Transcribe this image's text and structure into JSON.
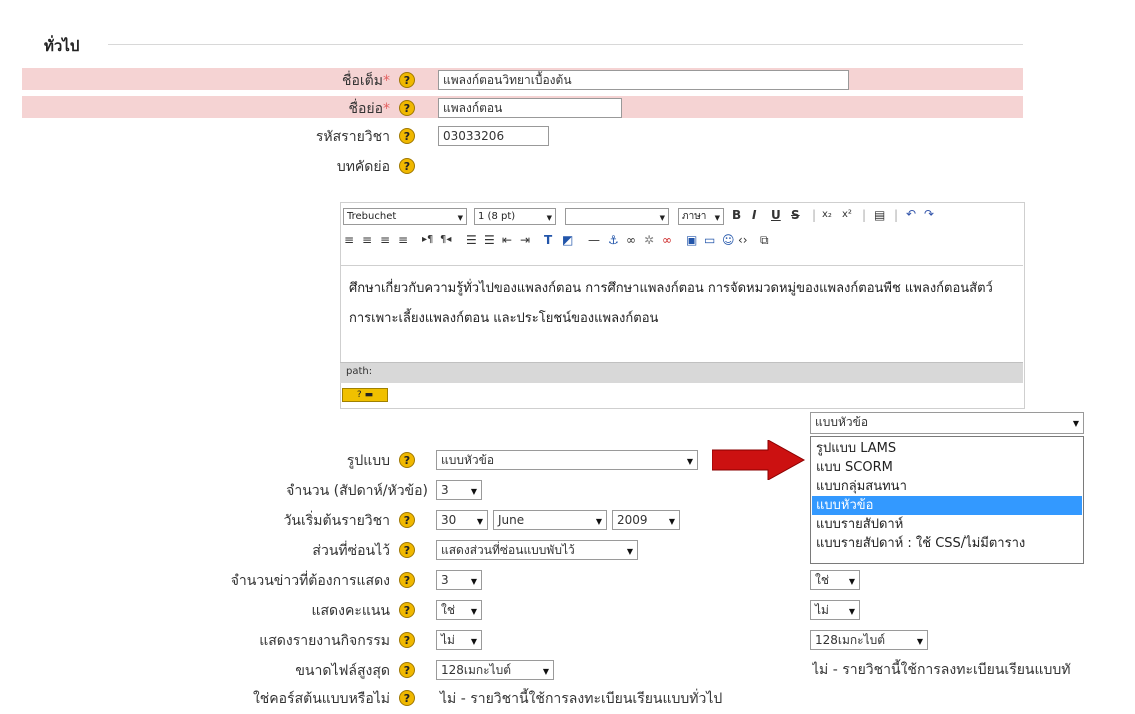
{
  "section": {
    "title": "ทั่วไป"
  },
  "fields": {
    "fullname": {
      "label": "ชื่อเต็ม",
      "required_mark": "*",
      "value": "แพลงก์ตอนวิทยาเบื้องต้น"
    },
    "shortname": {
      "label": "ชื่อย่อ",
      "required_mark": "*",
      "value": "แพลงก์ตอน"
    },
    "idnumber": {
      "label": "รหัสรายวิชา",
      "value": "03033206"
    },
    "summary": {
      "label": "บทคัดย่อ"
    },
    "format": {
      "label": "รูปแบบ",
      "value": "แบบหัวข้อ"
    },
    "numsections": {
      "label": "จำนวน (สัปดาห์/หัวข้อ)",
      "value": "3"
    },
    "startdate": {
      "label": "วันเริ่มต้นรายวิชา",
      "day": "30",
      "month": "June",
      "year": "2009"
    },
    "hiddensections": {
      "label": "ส่วนที่ซ่อนไว้",
      "value": "แสดงส่วนที่ซ่อนแบบพับไว้"
    },
    "newsitems": {
      "label": "จำนวนข่าวที่ต้องการแสดง",
      "value": "3"
    },
    "showgrades": {
      "label": "แสดงคะแนน",
      "value": "ใช่"
    },
    "showreports": {
      "label": "แสดงรายงานกิจกรรม",
      "value": "ไม่"
    },
    "maxbytes": {
      "label": "ขนาดไฟล์สูงสุด",
      "value": "128เมกะไบต์"
    },
    "metacourse": {
      "label": "ใช่คอร์สต้นแบบหรือไม่",
      "value": "ไม่ - รายวิชานี้ใช้การลงทะเบียนเรียนแบบทั่วไป"
    }
  },
  "help_glyph": "?",
  "editor": {
    "font": "Trebuchet",
    "size": "1 (8 pt)",
    "style": "",
    "lang": "ภาษา",
    "content": "ศึกษาเกี่ยวกับความรู้ทั่วไปของแพลงก์ตอน การศึกษาแพลงก์ตอน การจัดหมวดหมู่ของแพลงก์ตอนพืช แพลงก์ตอนสัตว์ การเพาะเลี้ยงแพลงก์ตอน และประโยชน์ของแพลงก์ตอน",
    "path_label": "path:"
  },
  "zoom_panel": {
    "format_value": "แบบหัวข้อ",
    "options": [
      "รูปแบบ LAMS",
      "แบบ SCORM",
      "แบบกลุ่มสนทนา",
      "แบบหัวข้อ",
      "แบบรายสัปดาห์",
      "แบบรายสัปดาห์ : ใช้ CSS/ไม่มีตาราง"
    ],
    "selected_index": 3,
    "showgrades_value": "ใช่",
    "showreports_value": "ไม่",
    "maxbytes_value": "128เมกะไบต์",
    "metacourse_value": "ไม่ - รายวิชานี้ใช้การลงทะเบียนเรียนแบบทั"
  },
  "colors": {
    "required_band": "#f5d3d3",
    "selected_option": "#3399ff",
    "arrow": "#cc1111"
  }
}
